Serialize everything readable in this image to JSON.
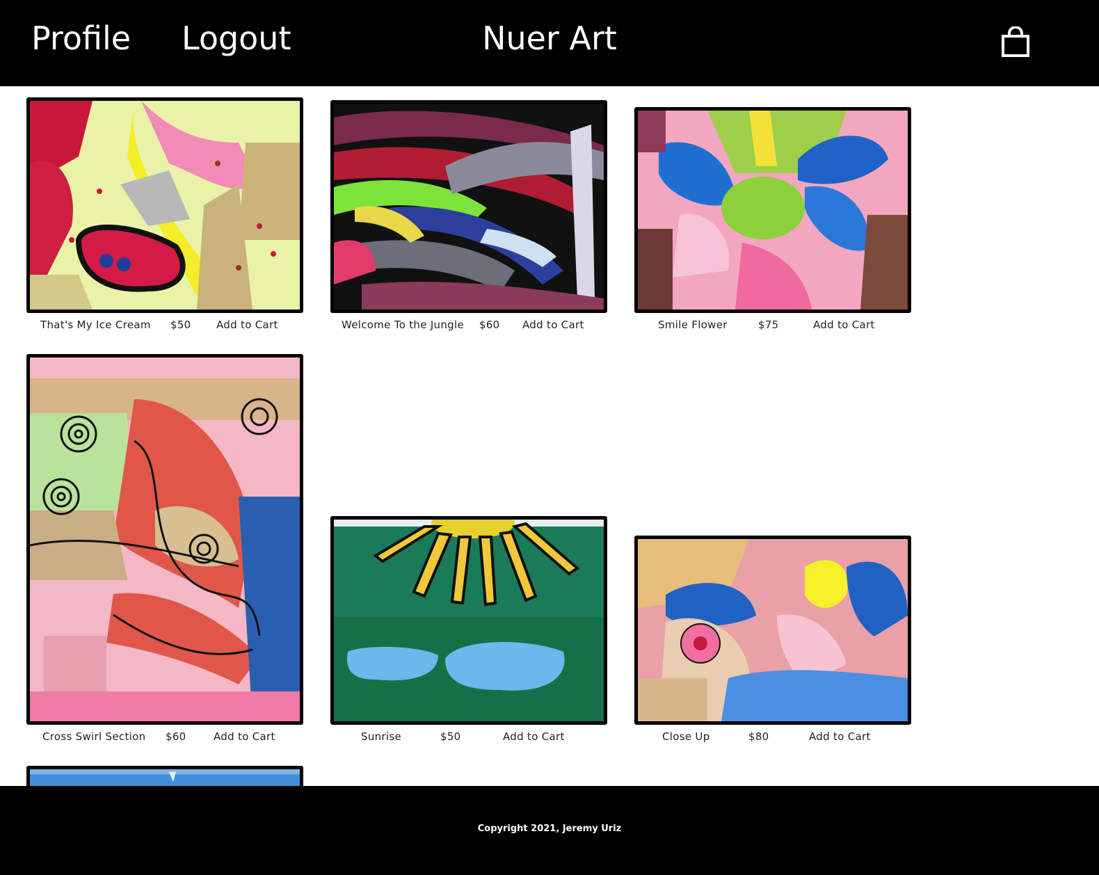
{
  "header": {
    "profile_label": "Profile",
    "logout_label": "Logout",
    "site_title": "Nuer Art",
    "cart_icon": "shopping-bag-icon"
  },
  "products": [
    {
      "title": "That's My Ice Cream",
      "price": "$50",
      "cta": "Add to Cart"
    },
    {
      "title": "Welcome To the Jungle",
      "price": "$60",
      "cta": "Add to Cart"
    },
    {
      "title": "Smile Flower",
      "price": "$75",
      "cta": "Add to Cart"
    },
    {
      "title": "Cross Swirl Section",
      "price": "$60",
      "cta": "Add to Cart"
    },
    {
      "title": "Sunrise",
      "price": "$50",
      "cta": "Add to Cart"
    },
    {
      "title": "Close Up",
      "price": "$80",
      "cta": "Add to Cart"
    }
  ],
  "footer": {
    "copyright": "Copyright 2021, Jeremy Uriz"
  },
  "colors": {
    "header_bg": "#000000",
    "footer_bg": "#000000",
    "page_bg": "#ffffff",
    "frame": "#000000"
  }
}
